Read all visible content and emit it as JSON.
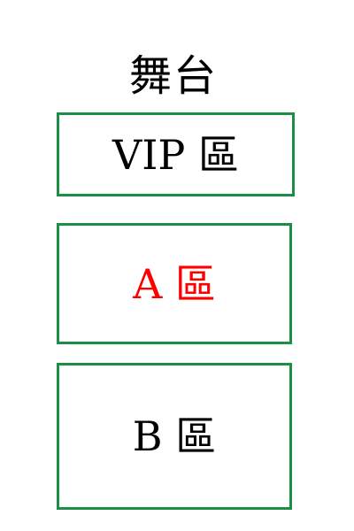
{
  "stage": {
    "label": "舞台"
  },
  "zones": [
    {
      "label": "VIP 區",
      "text_color": "#000000"
    },
    {
      "label": "A 區",
      "text_color": "#ff0000"
    },
    {
      "label": "B 區",
      "text_color": "#000000"
    }
  ],
  "colors": {
    "zone_border": "#1a8f45",
    "background": "#ffffff"
  }
}
